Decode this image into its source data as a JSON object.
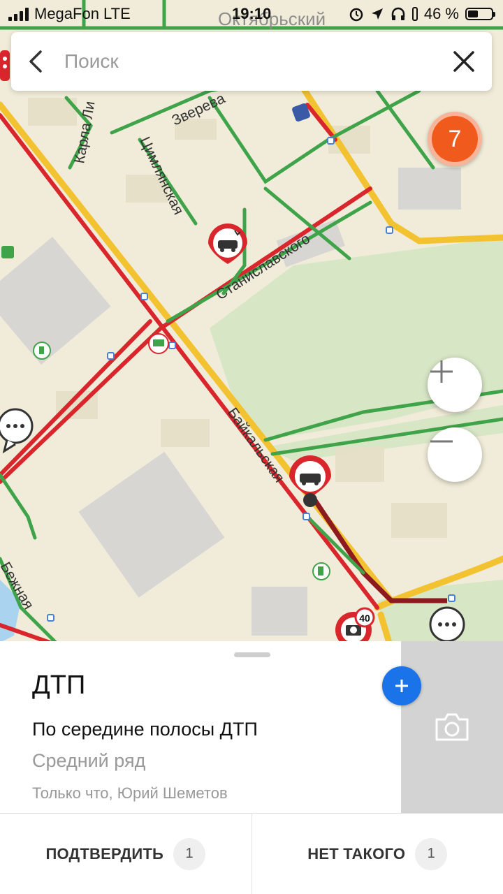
{
  "status_bar": {
    "carrier": "MegaFon LTE",
    "time": "19:10",
    "battery": "46 %",
    "battery_level": 0.46
  },
  "search": {
    "placeholder": "Поиск"
  },
  "map": {
    "streets": [
      "Карла Ли",
      "Зверева",
      "Цимлянская",
      "Станиславского",
      "Байкальская",
      "Октябрьский",
      "Бежная"
    ],
    "cluster_count": "7",
    "speed_limit": "40",
    "colors": {
      "road_jam": "#d9262c",
      "road_free": "#3fa34a",
      "road_major": "#f2c230",
      "park": "#d6e5c4",
      "building": "#e9e3cc",
      "cluster": "#f05a1c"
    }
  },
  "incident": {
    "title": "ДТП",
    "description": "По середине полосы ДТП",
    "lane": "Средний ряд",
    "meta": "Только что, Юрий Шеметов"
  },
  "actions": {
    "confirm_label": "ПОДТВЕРДИТЬ",
    "confirm_count": "1",
    "deny_label": "НЕТ ТАКОГО",
    "deny_count": "1"
  },
  "icons": [
    "back-arrow-icon",
    "close-icon",
    "plus-icon",
    "minus-icon",
    "camera-icon",
    "add-icon",
    "accident-icon",
    "chat-icon",
    "speed-camera-icon",
    "fuel-icon",
    "shop-icon",
    "ev-charger-icon"
  ]
}
